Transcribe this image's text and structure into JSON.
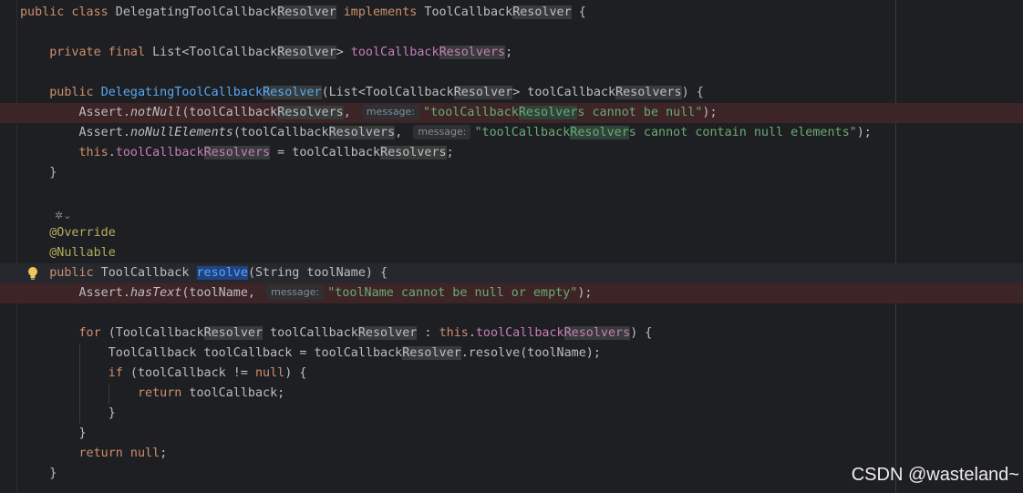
{
  "editor": {
    "lines": [
      {
        "html": "<span class=\"kw\">public class</span> DelegatingToolCallback<span class=\"hl\">Resolver</span> <span class=\"kw\">implements</span> ToolCallback<span class=\"hl\">Resolver</span> {"
      },
      {
        "html": ""
      },
      {
        "html": "    <span class=\"kw\">private final</span> List&lt;ToolCallback<span class=\"hl\">Resolver</span>&gt; <span class=\"fld\">toolCallback</span><span class=\"fld hl\">Resolvers</span>;"
      },
      {
        "html": ""
      },
      {
        "html": "    <span class=\"kw\">public</span> <span class=\"fn\">DelegatingToolCallback</span><span class=\"fn hl\">Resolver</span>(List&lt;ToolCallback<span class=\"hl\">Resolver</span>&gt; toolCallback<span class=\"hl\">Resolvers</span>) {"
      },
      {
        "html": "        Assert.<span class=\"it\">notNull</span>(toolCallback<span class=\"hl\">Resolvers</span>, <span class=\"hint\">message:</span><span class=\"str\">\"toolCallback<span class=\"hlstr\">Resolver</span>s cannot be null\"</span>);",
        "cls": "err"
      },
      {
        "html": "        Assert.<span class=\"it\">noNullElements</span>(toolCallback<span class=\"hl\">Resolvers</span>, <span class=\"hint\">message:</span><span class=\"str\">\"toolCallback<span class=\"hlstr\">Resolver</span>s cannot contain null elements\"</span>);"
      },
      {
        "html": "        <span class=\"kw\">this</span>.<span class=\"fld\">toolCallback</span><span class=\"fld hl\">Resolvers</span> = toolCallback<span class=\"hl\">Resolvers</span>;"
      },
      {
        "html": "    }"
      },
      {
        "html": ""
      },
      {
        "html": ""
      },
      {
        "html": "    <span class=\"ann\">@Override</span>"
      },
      {
        "html": "    <span class=\"ann\">@Nullable</span>"
      },
      {
        "html": "    <span class=\"kw\">public</span> ToolCallback <span class=\"fn sel\">resolve</span>(String toolName) {",
        "cls": "cur"
      },
      {
        "html": "        Assert.<span class=\"it\">hasText</span>(toolName, <span class=\"hint\">message:</span><span class=\"str\">\"toolName cannot be null or empty\"</span>);",
        "cls": "err"
      },
      {
        "html": ""
      },
      {
        "html": "        <span class=\"kw\">for</span> (ToolCallback<span class=\"hl\">Resolver</span> toolCallback<span class=\"hl\">Resolver</span> : <span class=\"kw\">this</span>.<span class=\"fld\">toolCallback</span><span class=\"fld hl\">Resolvers</span>) {"
      },
      {
        "html": "            ToolCallback toolCallback = toolCallback<span class=\"hl\">Resolver</span>.resolve(toolName);"
      },
      {
        "html": "            <span class=\"kw\">if</span> (toolCallback != <span class=\"kw\">null</span>) {"
      },
      {
        "html": "                <span class=\"kw\">return</span> toolCallback;"
      },
      {
        "html": "            }"
      },
      {
        "html": "        }"
      },
      {
        "html": "        <span class=\"kw\">return null</span>;"
      },
      {
        "html": "    }"
      }
    ]
  },
  "watermark": {
    "text": "CSDN @wasteland~"
  },
  "colors": {
    "background": "#1e1f22",
    "keyword": "#cf8e6d",
    "field": "#c77dbb",
    "method": "#56a8f5",
    "string": "#6aab73",
    "annotation": "#b3ae60",
    "error_line": "#3d2427"
  }
}
